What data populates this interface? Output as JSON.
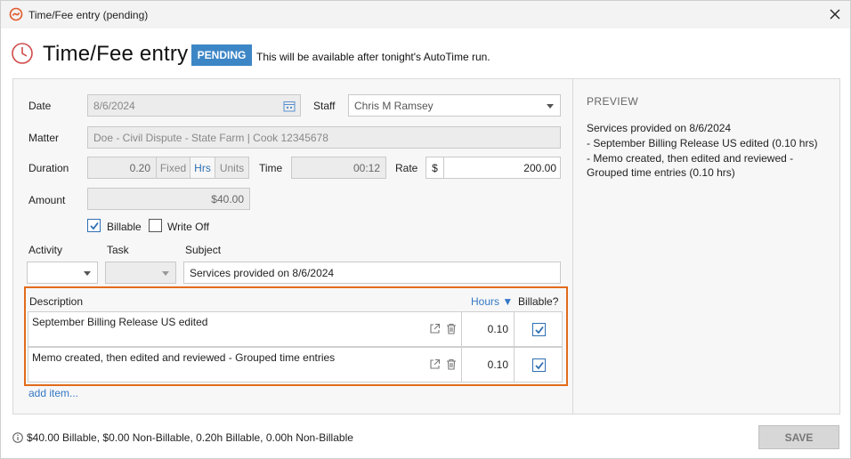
{
  "window": {
    "title": "Time/Fee entry (pending)"
  },
  "header": {
    "title": "Time/Fee entry",
    "badge": "PENDING",
    "note": "This will be available after tonight's AutoTime run."
  },
  "form": {
    "date_label": "Date",
    "date_value": "8/6/2024",
    "staff_label": "Staff",
    "staff_value": "Chris M Ramsey",
    "matter_label": "Matter",
    "matter_value": "Doe - Civil Dispute - State Farm | Cook 12345678",
    "duration_label": "Duration",
    "duration_value": "0.20",
    "duration_units": [
      "Fixed",
      "Hrs",
      "Units"
    ],
    "duration_selected": "Hrs",
    "time_label": "Time",
    "time_value": "00:12",
    "rate_label": "Rate",
    "rate_currency": "$",
    "rate_value": "200.00",
    "amount_label": "Amount",
    "amount_value": "$40.00",
    "billable_label": "Billable",
    "billable_checked": true,
    "writeoff_label": "Write Off",
    "writeoff_checked": false,
    "activity_label": "Activity",
    "activity_value": "",
    "task_label": "Task",
    "task_value": "",
    "subject_label": "Subject",
    "subject_value": "Services provided on 8/6/2024"
  },
  "description": {
    "header": "Description",
    "hours_header": "Hours ▼",
    "billable_header": "Billable?",
    "items": [
      {
        "text": "September Billing Release US edited",
        "hours": "0.10",
        "billable": true
      },
      {
        "text": "Memo created, then edited and reviewed - Grouped time entries",
        "hours": "0.10",
        "billable": true
      }
    ],
    "add_item": "add item..."
  },
  "preview": {
    "title": "PREVIEW",
    "lines": [
      "Services provided on 8/6/2024",
      "- September Billing Release US edited (0.10 hrs)",
      "- Memo created, then edited and reviewed -",
      "Grouped time entries (0.10 hrs)"
    ]
  },
  "footer": {
    "summary": "$40.00 Billable, $0.00 Non-Billable, 0.20h Billable, 0.00h Non-Billable",
    "save": "SAVE"
  },
  "colors": {
    "accent": "#3d86c6",
    "highlight_border": "#e26b1b",
    "link": "#3578c6"
  }
}
